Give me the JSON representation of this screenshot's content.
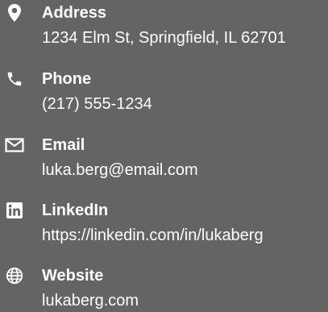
{
  "contacts": [
    {
      "icon": "location-pin-icon",
      "label": "Address",
      "value": "1234 Elm St, Springfield, IL 62701"
    },
    {
      "icon": "phone-icon",
      "label": "Phone",
      "value": "(217) 555-1234"
    },
    {
      "icon": "envelope-icon",
      "label": "Email",
      "value": "luka.berg@email.com"
    },
    {
      "icon": "linkedin-icon",
      "label": "LinkedIn",
      "value": "https://linkedin.com/in/lukaberg"
    },
    {
      "icon": "globe-icon",
      "label": "Website",
      "value": "lukaberg.com"
    }
  ],
  "colors": {
    "background": "#646464",
    "text": "#ffffff"
  }
}
